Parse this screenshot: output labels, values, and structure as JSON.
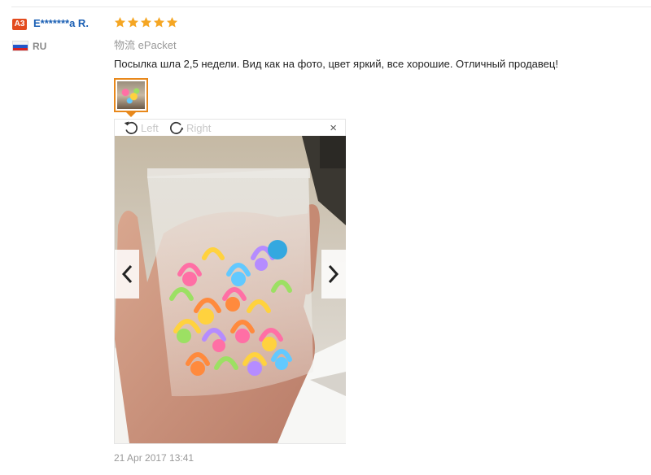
{
  "review": {
    "user_badge": "A3",
    "user_name": "E*******a R.",
    "country": "RU",
    "rating": 5,
    "shipping": "物流 ePacket",
    "feedback": "Посылка шла 2,5 недели. Вид как на фото, цвет яркий, все хорошие. Отличный продавец!",
    "timestamp": "21 Apr 2017 13:41"
  },
  "viewer": {
    "rotate_left_label": "Left",
    "rotate_right_label": "Right",
    "close_label": "×"
  },
  "colors": {
    "star": "#f5a623",
    "link": "#1a5fb4",
    "badge": "#e34b1e",
    "thumb_border": "#e8881b"
  },
  "icons": [
    "star-icon",
    "rotate-left-icon",
    "rotate-right-icon",
    "close-icon",
    "chevron-left-icon",
    "chevron-right-icon",
    "russia-flag-icon"
  ]
}
